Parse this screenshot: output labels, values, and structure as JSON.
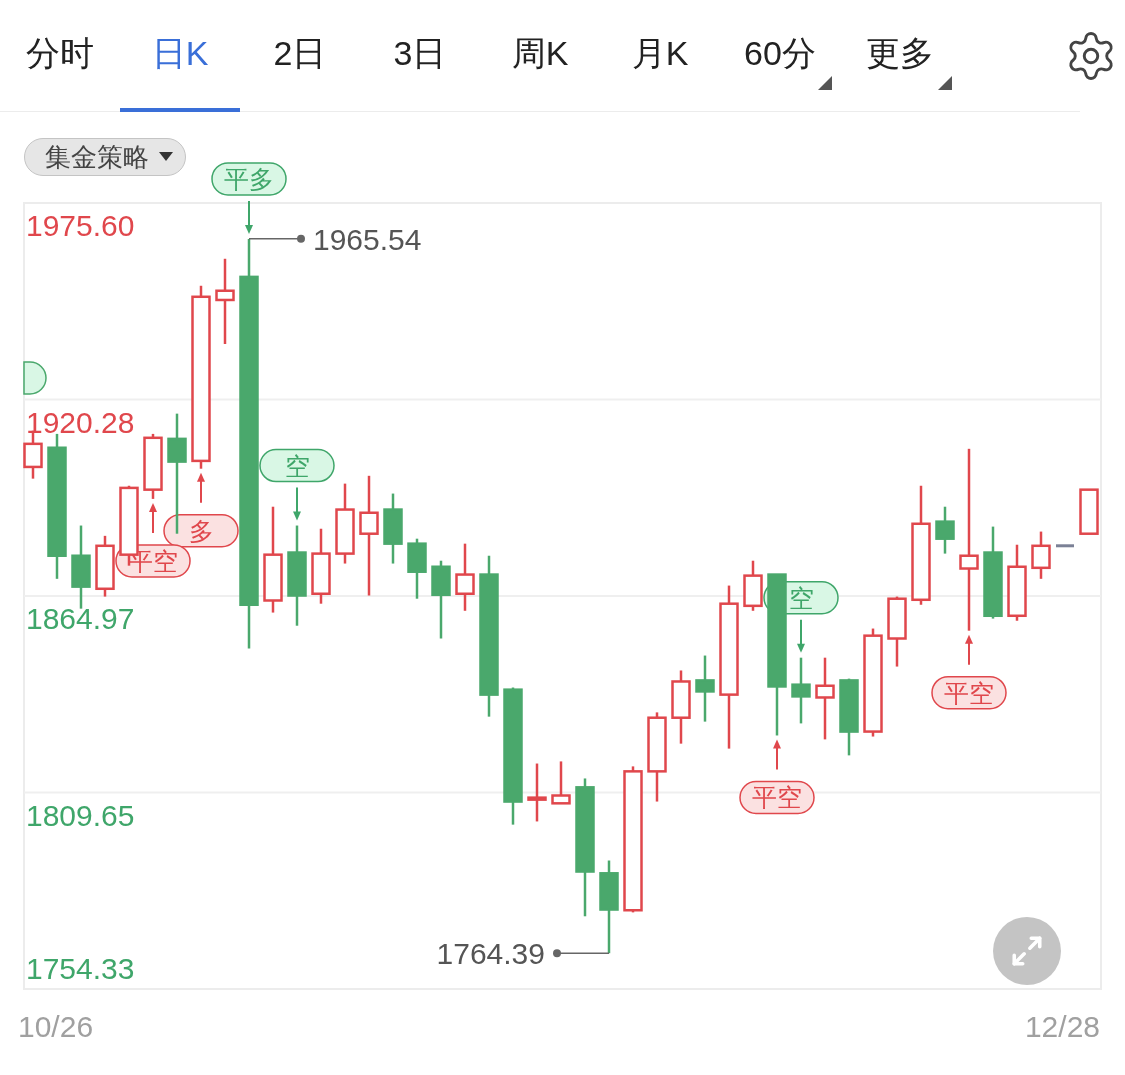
{
  "tabs": [
    {
      "label": "分时",
      "selected": false,
      "menu": false
    },
    {
      "label": "日K",
      "selected": true,
      "menu": false
    },
    {
      "label": "2日",
      "selected": false,
      "menu": false
    },
    {
      "label": "3日",
      "selected": false,
      "menu": false
    },
    {
      "label": "周K",
      "selected": false,
      "menu": false
    },
    {
      "label": "月K",
      "selected": false,
      "menu": false
    },
    {
      "label": "60分",
      "selected": false,
      "menu": true
    },
    {
      "label": "更多",
      "selected": false,
      "menu": true
    }
  ],
  "strategy_dropdown": {
    "label": "集金策略"
  },
  "chart": {
    "y_axis_labels": [
      {
        "text": "1975.60",
        "color": "#e0474c"
      },
      {
        "text": "1920.28",
        "color": "#e0474c"
      },
      {
        "text": "1864.97",
        "color": "#3fa66a"
      },
      {
        "text": "1809.65",
        "color": "#3fa66a"
      },
      {
        "text": "1754.33",
        "color": "#3fa66a"
      }
    ],
    "signals": [
      {
        "label": "平多",
        "color": "#3fa66a"
      },
      {
        "label": "空",
        "color": "#3fa66a"
      },
      {
        "label": "多",
        "color": "#e0474c"
      },
      {
        "label": "平空",
        "color": "#e0474c"
      },
      {
        "label": "空",
        "color": "#3fa66a"
      },
      {
        "label": "平空",
        "color": "#e0474c"
      },
      {
        "label": "平空",
        "color": "#e0474c"
      }
    ],
    "price_labels": [
      "1965.54",
      "1764.39"
    ],
    "date_labels": [
      "10/26",
      "12/28"
    ]
  }
}
